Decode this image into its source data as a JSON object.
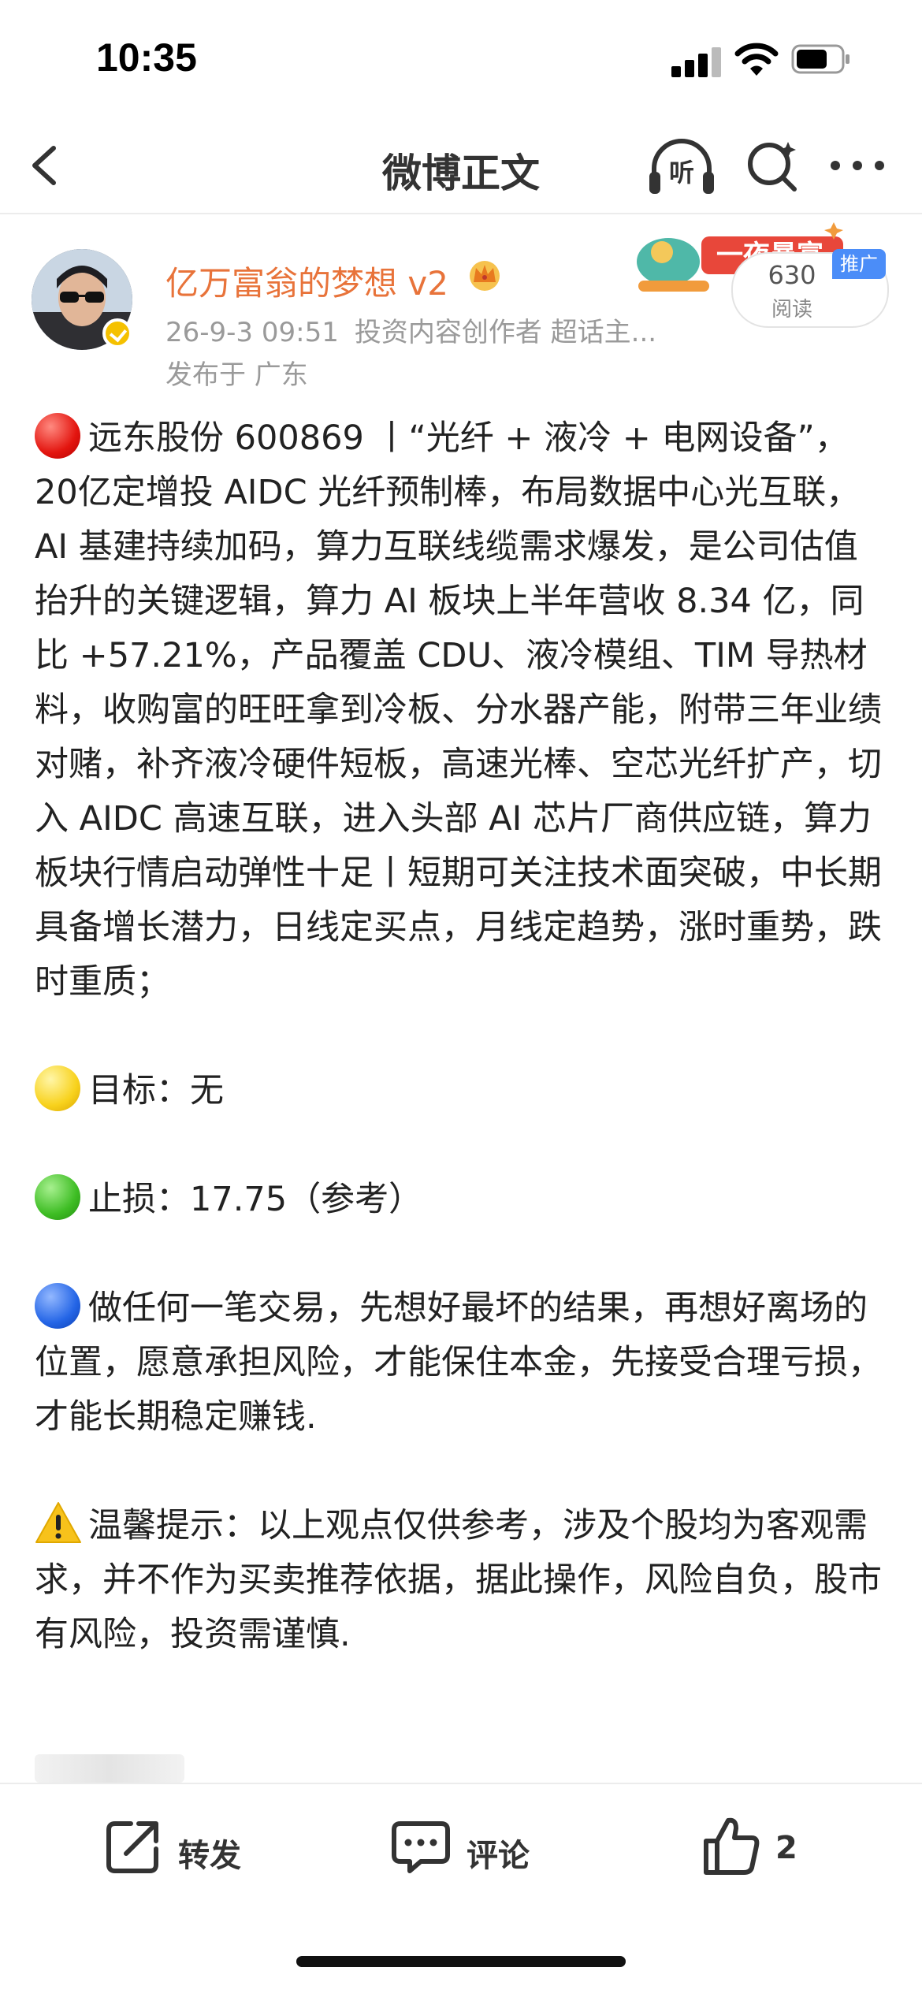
{
  "status_bar": {
    "time": "10:35"
  },
  "nav": {
    "title": "微博正文",
    "listen_label": "听"
  },
  "author": {
    "name": "亿万富翁的梦想 v2",
    "meta": [
      "26-9-3 09:51",
      "投资内容创作者 超话主..."
    ],
    "location": "发布于 广东"
  },
  "promo": {
    "banner_text": "一夜暴富",
    "read_count": "630",
    "read_label": "阅读",
    "ad_tag": "推广"
  },
  "post": {
    "paragraph_1": "远东股份 600869 丨“光纤 + 液冷 + 电网设备”，20亿定增投 AIDC 光纤预制棒，布局数据中心光互联，AI 基建持续加码，算力互联线缆需求爆发，是公司估值抬升的关键逻辑，算力 AI 板块上半年营收 8.34 亿，同比 +57.21%，产品覆盖 CDU、液冷模组、TIM 导热材料，收购富的旺旺拿到冷板、分水器产能，附带三年业绩对赌，补齐液冷硬件短板，高速光棒、空芯光纤扩产，切入 AIDC 高速互联，进入头部 AI 芯片厂商供应链，算力板块行情启动弹性十足丨短期可关注技术面突破，中长期具备增长潜力，日线定买点，月线定趋势，涨时重势，跌时重质；",
    "target": "目标：无",
    "stop_loss": "止损：17.75（参考）",
    "advice": "做任何一笔交易，先想好最坏的结果，再想好离场的位置，愿意承担风险，才能保住本金，先接受合理亏损，才能长期稳定赚钱.",
    "disclaimer": "温馨提示：以上观点仅供参考，涉及个股均为客观需求，并不作为买卖推荐依据，据此操作，风险自负，股市有风险，投资需谨慎."
  },
  "actions": {
    "repost_label": "转发",
    "comment_label": "评论",
    "like_count": "2"
  },
  "colors": {
    "author_name": "#e8733a",
    "meta_text": "#9a9a9a",
    "ad_tag": "#4b8df8"
  }
}
